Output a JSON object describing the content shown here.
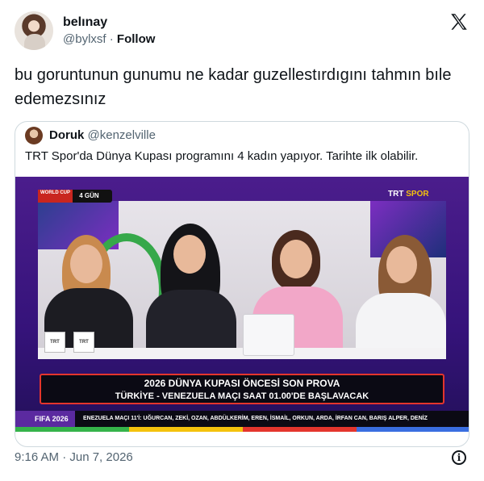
{
  "tweet": {
    "display_name": "belınay",
    "handle": "@bylxsf",
    "separator": "·",
    "follow_label": "Follow",
    "text": "bu goruntunun gunumu ne kadar guzellestırdıgını tahmın bıle edemezsınız",
    "timestamp": "9:16 AM · Jun 7, 2026",
    "icons": {
      "logo": "x-logo-icon",
      "info": "info-icon"
    }
  },
  "quoted": {
    "display_name": "Doruk",
    "handle": "@kenzelville",
    "text": "TRT Spor'da Dünya Kupası programını 4 kadın yapıyor. Tarihte ilk olabilir.",
    "media": {
      "badge_world_cup": "WORLD CUP",
      "badge_days": "4 GÜN",
      "channel_logo_a": "TRT",
      "channel_logo_b": "SPOR",
      "mug_label": "TRT",
      "headline": "2026 DÜNYA KUPASI ÖNCESİ SON PROVA",
      "subheadline": "TÜRKİYE - VENEZUELA MAÇI SAAT 01.00'DE BAŞLAVACAK",
      "ticker_label": "FIFA 2026",
      "ticker_text": "ENEZUELA MAÇI 11'İ: UĞURCAN, ZEKİ, OZAN, ABDÜLKERİM, EREN, İSMAİL, ORKUN, ARDA, İRFAN CAN, BARIŞ ALPER, DENİZ"
    }
  },
  "colors": {
    "text": "#0f1419",
    "muted": "#536471",
    "border": "#cfd9de",
    "tv_purple": "#4b1d8c",
    "lower_third_border": "#e4352d"
  }
}
